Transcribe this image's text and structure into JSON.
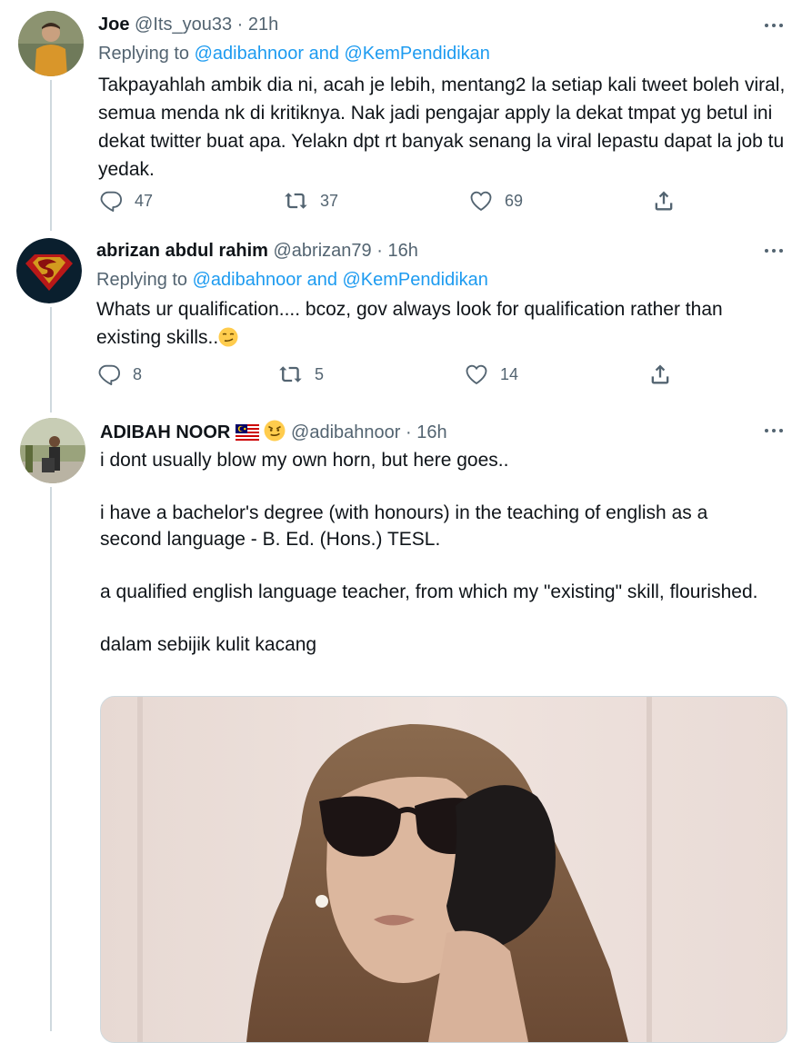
{
  "tweets": [
    {
      "name": "Joe",
      "handle": "@Its_you33",
      "sep": "·",
      "time": "21h",
      "replying_prefix": "Replying to ",
      "replying_to": "@adibahnoor and @KemPendidikan",
      "text": "Takpayahlah ambik dia ni, acah je lebih, mentang2 la setiap kali tweet boleh viral, semua menda nk di kritiknya. Nak jadi pengajar apply la dekat tmpat yg betul ini dekat twitter buat apa. Yelakn dpt rt banyak senang la viral lepastu dapat la job tu yedak.",
      "replies": "47",
      "retweets": "37",
      "likes": "69"
    },
    {
      "name": "abrizan abdul rahim",
      "handle": "@abrizan79",
      "sep": "·",
      "time": "16h",
      "replying_prefix": "Replying to ",
      "replying_to": "@adibahnoor and @KemPendidikan",
      "text": "Whats ur qualification.... bcoz, gov always look for qualification rather than existing skills..",
      "replies": "8",
      "retweets": "5",
      "likes": "14"
    },
    {
      "name": "ADIBAH NOOR",
      "handle": "@adibahnoor",
      "sep": "·",
      "time": "16h",
      "text": "i dont usually blow my own horn, but here goes..\n\ni have a bachelor's degree (with honours) in the teaching of english as a second language - B. Ed. (Hons.) TESL.\n\na qualified english language teacher, from which my \"existing\" skill, flourished.\n\ndalam sebijik kulit kacang"
    }
  ],
  "colors": {
    "accent": "#1d9bf0",
    "secondary_text": "#536471",
    "thread_line": "#cfd9de"
  },
  "icons": [
    "reply-icon",
    "retweet-icon",
    "like-icon",
    "share-icon",
    "more-icon",
    "malaysia-flag-icon",
    "smirk-emoji-icon"
  ]
}
